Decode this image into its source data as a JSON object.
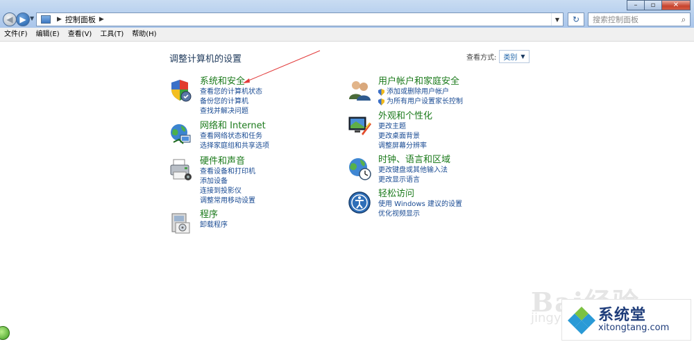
{
  "address": {
    "crumb": "控制面板",
    "search_placeholder": "搜索控制面板"
  },
  "menu": [
    "文件(F)",
    "编辑(E)",
    "查看(V)",
    "工具(T)",
    "帮助(H)"
  ],
  "main": {
    "title": "调整计算机的设置",
    "viewby_label": "查看方式:",
    "viewby_value": "类别",
    "left": [
      {
        "heading": "系统和安全",
        "links": [
          "查看您的计算机状态",
          "备份您的计算机",
          "查找并解决问题"
        ]
      },
      {
        "heading": "网络和 Internet",
        "links": [
          "查看网络状态和任务",
          "选择家庭组和共享选项"
        ]
      },
      {
        "heading": "硬件和声音",
        "links": [
          "查看设备和打印机",
          "添加设备",
          "连接到投影仪",
          "调整常用移动设置"
        ]
      },
      {
        "heading": "程序",
        "links": [
          "卸载程序"
        ]
      }
    ],
    "right": [
      {
        "heading": "用户帐户和家庭安全",
        "links": [
          "添加或删除用户帐户",
          "为所有用户设置家长控制"
        ]
      },
      {
        "heading": "外观和个性化",
        "links": [
          "更改主题",
          "更改桌面背景",
          "调整屏幕分辨率"
        ]
      },
      {
        "heading": "时钟、语言和区域",
        "links": [
          "更改键盘或其他输入法",
          "更改显示语言"
        ]
      },
      {
        "heading": "轻松访问",
        "links": [
          "使用 Windows 建议的设置",
          "优化视频显示"
        ]
      }
    ]
  },
  "watermark": {
    "baidu": "Bai经验",
    "jingyan": "jingyan.baidu.com",
    "site_name": "系统堂",
    "site_url": "xitongtang.com"
  },
  "colors": {
    "heading_green": "#1b7a1b",
    "link_blue": "#1a4b93",
    "title_blue": "#1e395b"
  }
}
